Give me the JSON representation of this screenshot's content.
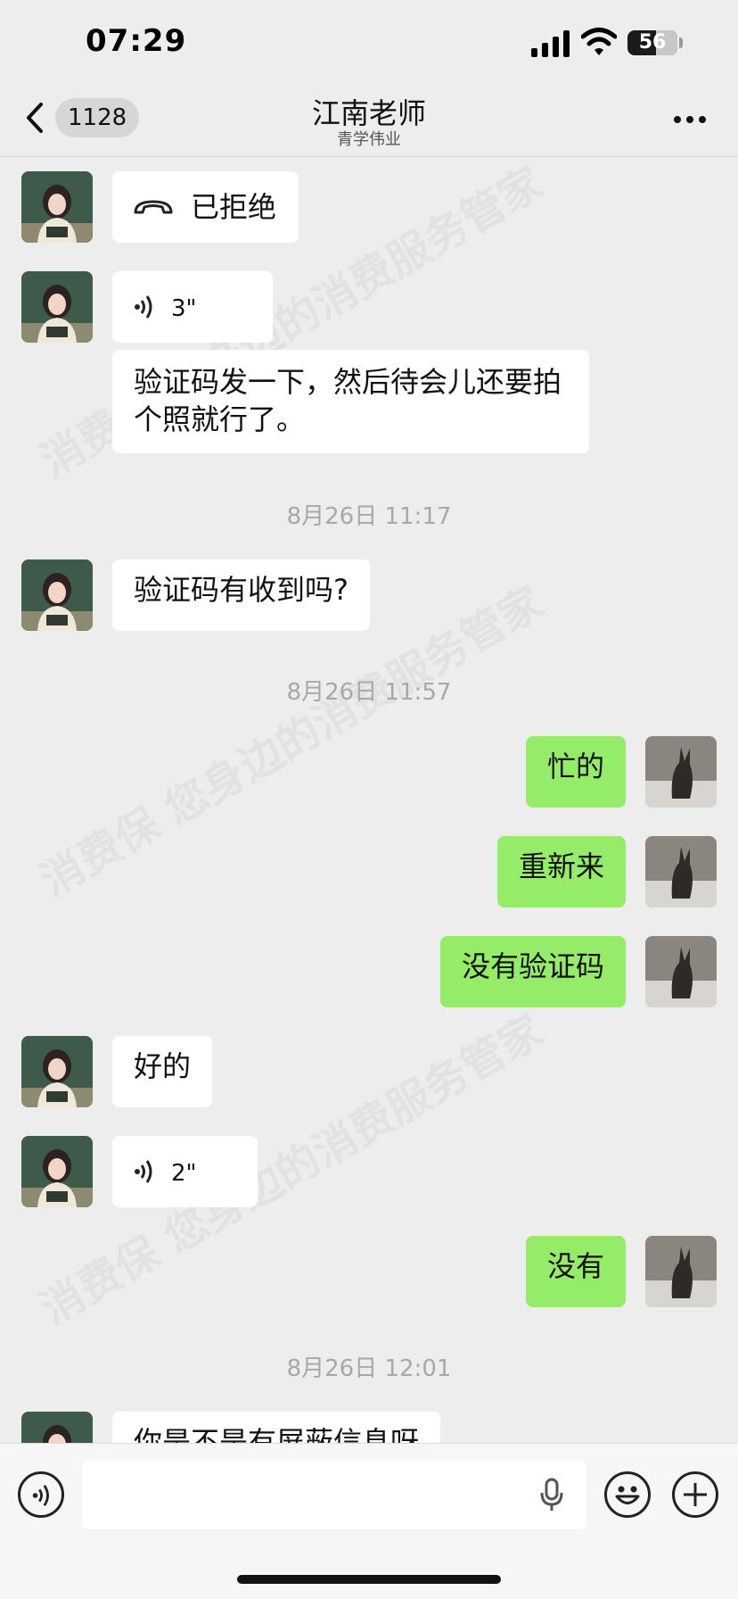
{
  "status_bar": {
    "time": "07:29",
    "battery": "56"
  },
  "nav": {
    "back_count": "1128",
    "title": "江南老师",
    "subtitle": "青学伟业"
  },
  "watermark": {
    "text": "消费保 您身边的消费服务管家"
  },
  "messages": {
    "call": {
      "text": "已拒绝"
    },
    "voice1": {
      "duration": "3\""
    },
    "text1": {
      "text": "验证码发一下，然后待会儿还要拍个照就行了。"
    },
    "ts1": {
      "text": "8月26日 11:17"
    },
    "text2": {
      "text": "验证码有收到吗?"
    },
    "ts2": {
      "text": "8月26日 11:57"
    },
    "me1": {
      "text": "忙的"
    },
    "me2": {
      "text": "重新来"
    },
    "me3": {
      "text": "没有验证码"
    },
    "text3": {
      "text": "好的"
    },
    "voice2": {
      "duration": "2\""
    },
    "me4": {
      "text": "没有"
    },
    "ts3": {
      "text": "8月26日 12:01"
    },
    "text4": {
      "text": "你是不是有屏蔽信息呀"
    }
  },
  "icons": {
    "back": "chevron-left-icon",
    "more": "ellipsis-icon",
    "call": "phone-hangup-icon",
    "voice": "voice-wave-icon",
    "voice_input": "voice-input-icon",
    "mic": "microphone-icon",
    "emoji": "emoji-icon",
    "plus": "plus-icon"
  },
  "colors": {
    "background": "#ededed",
    "my_bubble": "#95ec69",
    "their_bubble": "#ffffff"
  }
}
